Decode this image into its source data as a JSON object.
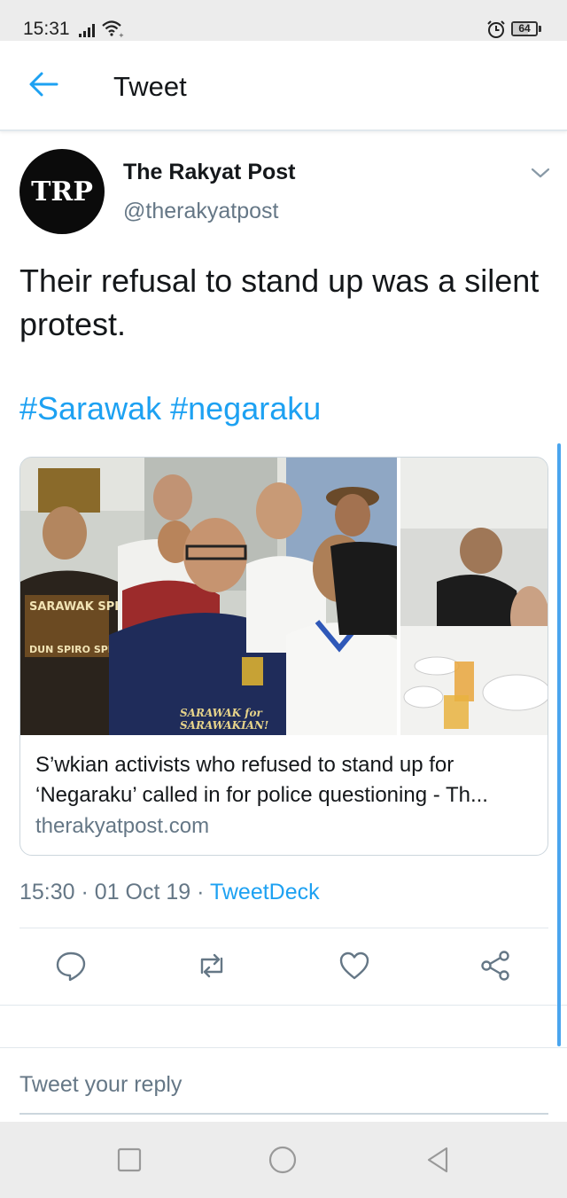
{
  "status_bar": {
    "time": "15:31",
    "battery": "64",
    "battery_level_percent": 64,
    "icons": [
      "signal-icon",
      "wifi-icon",
      "alarm-icon",
      "battery-icon"
    ]
  },
  "header": {
    "title": "Tweet",
    "back_icon": "arrow-left-icon"
  },
  "tweet": {
    "author": {
      "avatar_text": "TRP",
      "name": "The Rakyat Post",
      "handle": "@therakyatpost"
    },
    "text": "Their refusal to stand up was a silent protest.",
    "hashtags": [
      "#Sarawak",
      "#negaraku"
    ],
    "link_card": {
      "title": "S’wkian activists who refused to stand up for ‘Negaraku’ called in for police questioning - Th...",
      "domain": "therakyatpost.com",
      "image_text": {
        "shirt_line_1": "SARAWAK for",
        "shirt_line_2": "SARAWAKIAN!",
        "tshirt_top": "SARAWAK SPIRIT",
        "tshirt_bottom": "DUN SPIRO SPERO"
      }
    },
    "meta": {
      "time": "15:30",
      "separator": "·",
      "date": "01 Oct 19",
      "source": "TweetDeck"
    },
    "actions": [
      "reply-icon",
      "retweet-icon",
      "like-icon",
      "share-icon"
    ]
  },
  "reply": {
    "placeholder": "Tweet your reply"
  },
  "colors": {
    "accent": "#1da1f2",
    "text": "#14171a",
    "muted": "#657786",
    "divider": "#e1e8ed"
  }
}
